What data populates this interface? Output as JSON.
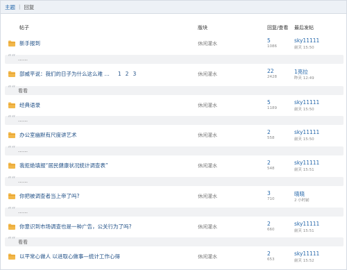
{
  "tabs": [
    {
      "label": "主题",
      "active": true
    },
    {
      "label": "回复",
      "active": false
    }
  ],
  "columns": {
    "topic": "帖子",
    "board": "版块",
    "stats": "回复/查看",
    "last": "最后发帖"
  },
  "colors": {
    "link": "#1f4f86",
    "accent": "#1f63a8",
    "folder": "#f2b84b"
  },
  "rows": [
    {
      "title": "新手报到",
      "pages": [],
      "board": "休闲灌水",
      "replies": "5",
      "views": "1086",
      "user": "sky11111",
      "time": "前天 15:50",
      "preview": ""
    },
    {
      "title": "",
      "pages": [],
      "board": "",
      "replies": "",
      "views": "",
      "user": "",
      "time": "",
      "preview": "……"
    },
    {
      "title": "部威平说：我们的日子为什么这么难 …",
      "pages": [
        "1",
        "2",
        "3"
      ],
      "board": "休闲灌水",
      "replies": "22",
      "views": "2428",
      "user": "1亮拉",
      "time": "昨天 12:49",
      "preview": "看看"
    },
    {
      "title": "经典语录",
      "pages": [],
      "board": "休闲灌水",
      "replies": "5",
      "views": "1189",
      "user": "sky11111",
      "time": "前天 15:50",
      "preview": "……"
    },
    {
      "title": "办公室幽默有尺度讲艺术",
      "pages": [],
      "board": "休闲灌水",
      "replies": "2",
      "views": "558",
      "user": "sky11111",
      "time": "前天 15:50",
      "preview": "……"
    },
    {
      "title": "我拒绝填报“居民健康状况统计调查表”",
      "pages": [],
      "board": "休闲灌水",
      "replies": "2",
      "views": "548",
      "user": "sky11111",
      "time": "前天 15:51",
      "preview": "……"
    },
    {
      "title": "你把被调查者当上帝了吗?",
      "pages": [],
      "board": "休闲灌水",
      "replies": "3",
      "views": "710",
      "user": "晓晓",
      "time": "2 小时前",
      "preview": "……"
    },
    {
      "title": "你意识到市场调查也是一种广告，公关行为了吗?",
      "pages": [],
      "board": "休闲灌水",
      "replies": "2",
      "views": "660",
      "user": "sky11111",
      "time": "前天 15:51",
      "preview": "看看"
    },
    {
      "title": "以平常心做人 以进取心做事—统计工作心得",
      "pages": [],
      "board": "休闲灌水",
      "replies": "2",
      "views": "653",
      "user": "sky11111",
      "time": "前天 15:52",
      "preview": ""
    }
  ]
}
